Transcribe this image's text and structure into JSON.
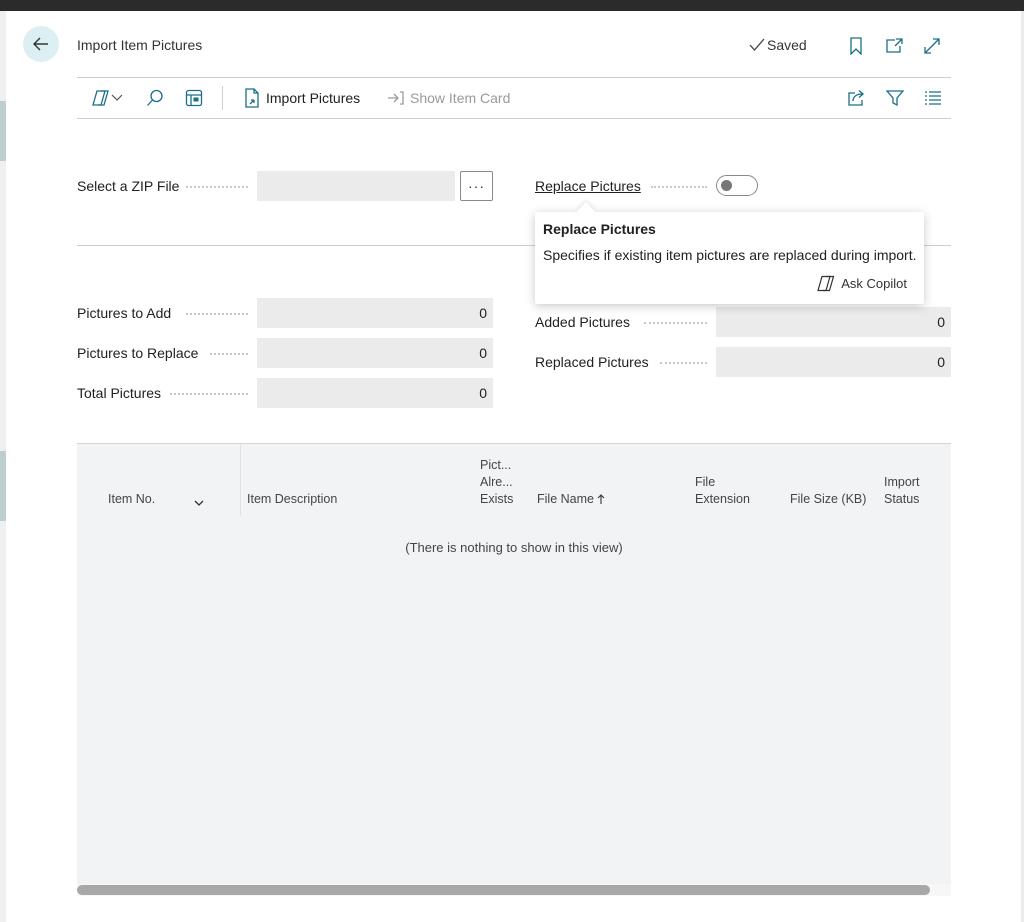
{
  "header": {
    "title": "Import Item Pictures",
    "saved_status": "Saved"
  },
  "actions": {
    "import_pictures": "Import Pictures",
    "show_item_card": "Show Item Card"
  },
  "fields": {
    "zip_label": "Select a ZIP File",
    "zip_value": "",
    "ellipsis": "···",
    "replace_label": "Replace Pictures",
    "replace_value": false,
    "pictures_to_add_label": "Pictures to Add",
    "pictures_to_add": "0",
    "pictures_to_replace_label": "Pictures to Replace",
    "pictures_to_replace": "0",
    "total_pictures_label": "Total Pictures",
    "total_pictures": "0",
    "added_pictures_label": "Added Pictures",
    "added_pictures": "0",
    "replaced_pictures_label": "Replaced Pictures",
    "replaced_pictures": "0"
  },
  "tooltip": {
    "title": "Replace Pictures",
    "text": "Specifies if existing item pictures are replaced during import.",
    "ask_copilot": "Ask Copilot"
  },
  "grid": {
    "columns": {
      "item_no": "Item No.",
      "item_description": "Item Description",
      "picture_exists_1": "Pict...",
      "picture_exists_2": "Alre...",
      "picture_exists_3": "Exists",
      "file_name": "File Name",
      "file_extension_1": "File",
      "file_extension_2": "Extension",
      "file_size": "File Size (KB)",
      "import_status_1": "Import",
      "import_status_2": "Status"
    },
    "empty_message": "(There is nothing to show in this view)"
  },
  "colors": {
    "accent_back": "#dceff2",
    "field_bg": "#ebebeb",
    "grid_bg": "#f2f3f5"
  }
}
